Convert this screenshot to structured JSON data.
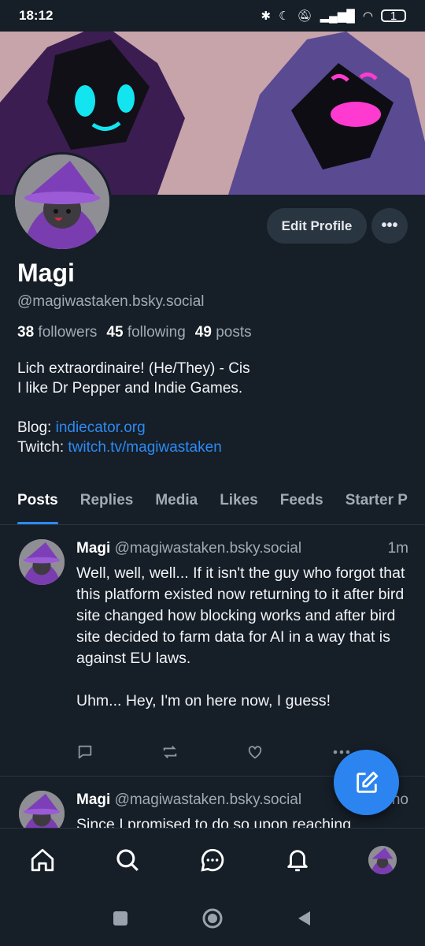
{
  "status": {
    "time": "18:12",
    "battery": "1"
  },
  "profile": {
    "name": "Magi",
    "handle": "@magiwastaken.bsky.social",
    "followers_count": "38",
    "followers_label": "followers",
    "following_count": "45",
    "following_label": "following",
    "posts_count": "49",
    "posts_label": "posts",
    "bio_line1": "Lich extraordinaire! (He/They) - Cis",
    "bio_line2": "I like Dr Pepper and Indie Games.",
    "blog_label": "Blog: ",
    "blog_link": "indiecator.org",
    "twitch_label": "Twitch: ",
    "twitch_link": "twitch.tv/magiwastaken",
    "edit_label": "Edit Profile",
    "more_label": "•••"
  },
  "tabs": [
    "Posts",
    "Replies",
    "Media",
    "Likes",
    "Feeds",
    "Starter P"
  ],
  "posts": [
    {
      "author": "Magi",
      "handle": "@magiwastaken.bsky.social",
      "time": "1m",
      "text": "Well, well, well... If it isn't the guy who forgot that this platform existed now returning to it after bird site changed how blocking works and after bird site decided to farm data for AI in a way that is against EU laws.\n\nUhm... Hey, I'm on here now, I guess!"
    },
    {
      "author": "Magi",
      "handle": "@magiwastaken.bsky.social",
      "time": "no",
      "text": "Since I promised to do so upon reaching"
    }
  ],
  "colors": {
    "accent": "#2c8bf4",
    "background": "#161e27",
    "muted": "#a1aab5"
  },
  "icons": {
    "reply": "comment-icon",
    "repost": "repost-icon",
    "like": "heart-icon",
    "more": "more-icon",
    "compose": "compose-icon",
    "home": "home-icon",
    "search": "search-icon",
    "chat": "chat-icon",
    "notifications": "bell-icon"
  }
}
